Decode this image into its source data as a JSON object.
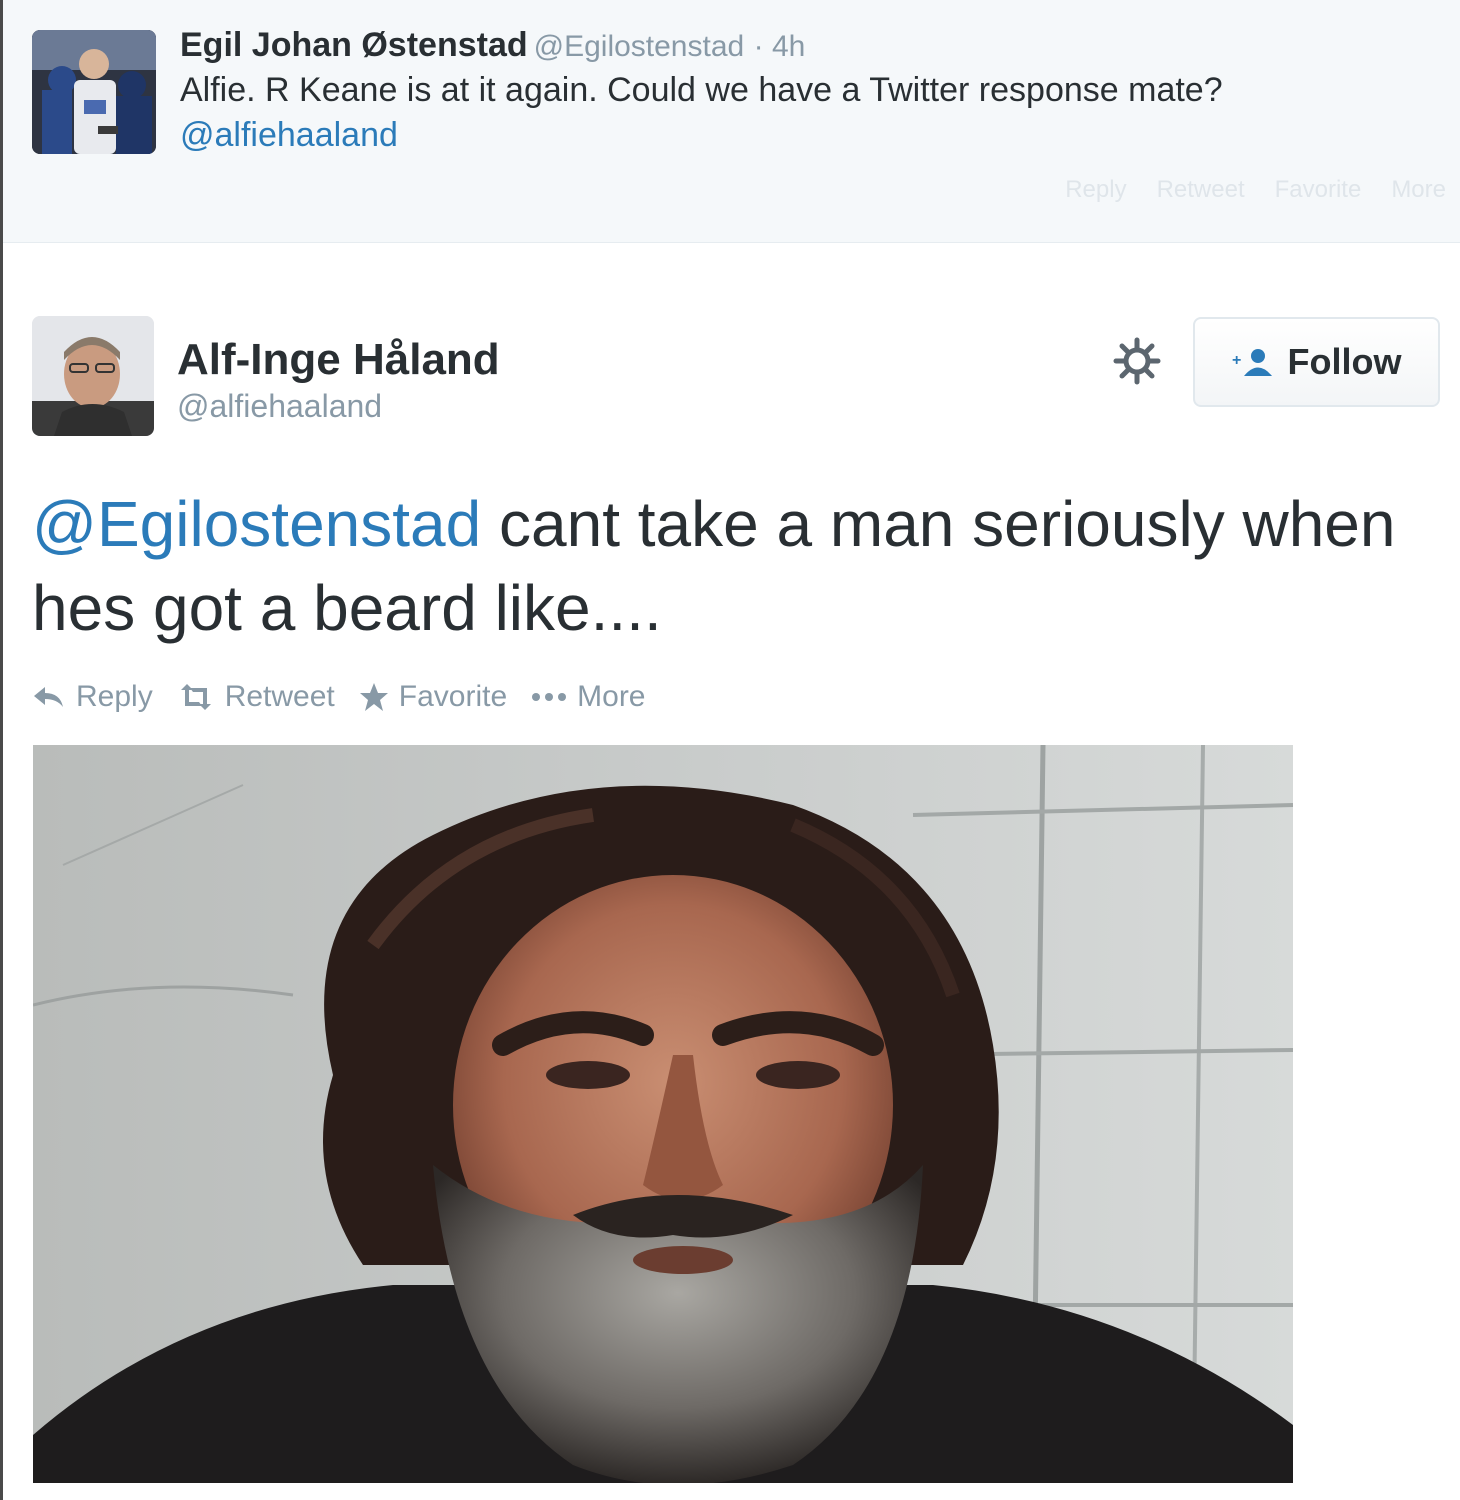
{
  "parent_tweet": {
    "name": "Egil Johan Østenstad",
    "handle": "@Egilostenstad",
    "time": "· 4h",
    "text": "Alfie. R Keane is at it again. Could we have a Twitter response mate?",
    "mention": "@alfiehaaland",
    "actions": [
      "Reply",
      "Retweet",
      "Favorite",
      "More"
    ],
    "avatar_icon": "user-photo-avatar"
  },
  "main_tweet": {
    "name": "Alf-Inge Håland",
    "handle": "@alfiehaaland",
    "follow_label": "Follow",
    "mention": "@Egilostenstad",
    "text": " cant take a man seriously when hes got a beard like....",
    "actions": {
      "reply": "Reply",
      "retweet": "Retweet",
      "favorite": "Favorite",
      "more": "More"
    },
    "media_description_icon": "attached-photo"
  },
  "colors": {
    "link": "#2b7bb9",
    "muted": "#8899a6",
    "text": "#292f33",
    "parent_bg": "#f5f8fa"
  }
}
